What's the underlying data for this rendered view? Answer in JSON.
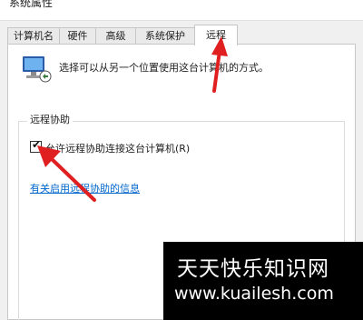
{
  "window": {
    "title": "系统属性"
  },
  "tabs": [
    {
      "label": "计算机名",
      "active": false
    },
    {
      "label": "硬件",
      "active": false
    },
    {
      "label": "高级",
      "active": false
    },
    {
      "label": "系统保护",
      "active": false
    },
    {
      "label": "远程",
      "active": true
    }
  ],
  "remote_tab": {
    "intro_text": "选择可以从另一个位置使用这台计算机的方式。",
    "remote_assistance": {
      "group_title": "远程协助",
      "allow_checkbox": {
        "label": "允许远程协助连接这台计算机(R)",
        "checked": true
      },
      "help_link": "有关启用远程协助的信息"
    }
  },
  "watermark": {
    "title": "天天快乐知识网",
    "url": "www.kuailesh.com"
  },
  "annotations": {
    "arrow_color": "#e02020"
  },
  "icons": {
    "computer": "remote-computer-icon",
    "check": "checkmark-icon"
  }
}
